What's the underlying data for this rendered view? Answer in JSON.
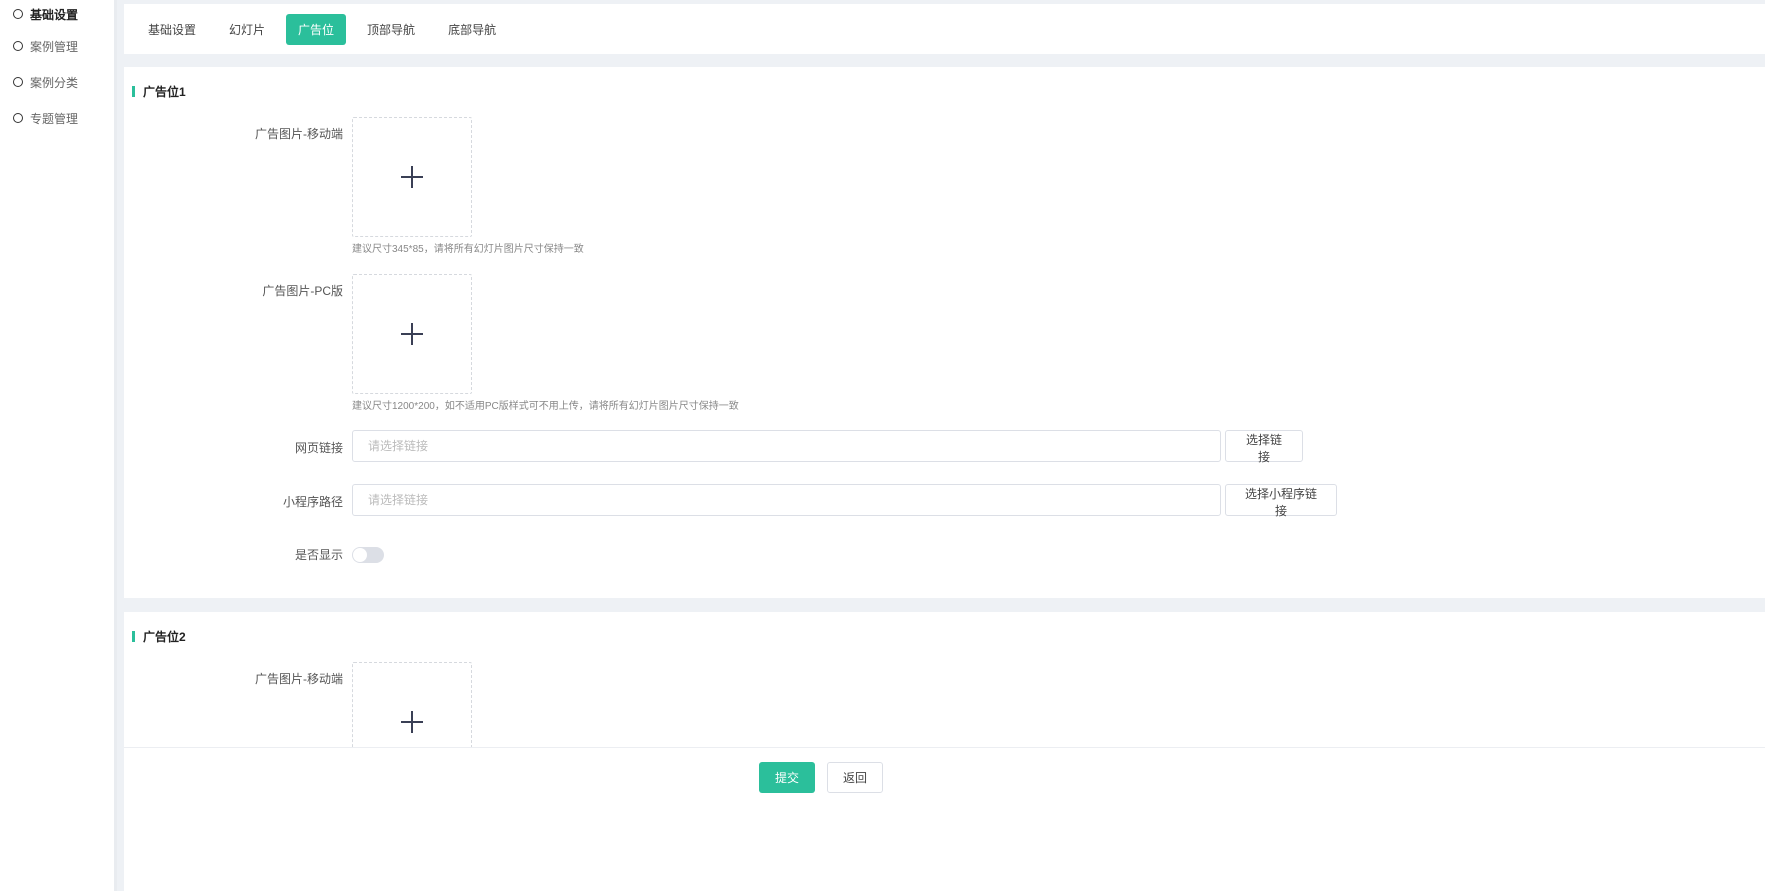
{
  "sidebar": {
    "items": [
      {
        "label": "基础设置",
        "active": true
      },
      {
        "label": "案例管理",
        "active": false
      },
      {
        "label": "案例分类",
        "active": false
      },
      {
        "label": "专题管理",
        "active": false
      }
    ]
  },
  "tabs": [
    {
      "label": "基础设置",
      "active": false
    },
    {
      "label": "幻灯片",
      "active": false
    },
    {
      "label": "广告位",
      "active": true
    },
    {
      "label": "顶部导航",
      "active": false
    },
    {
      "label": "底部导航",
      "active": false
    }
  ],
  "ad1": {
    "title": "广告位1",
    "mobile_label": "广告图片-移动端",
    "mobile_hint": "建议尺寸345*85，请将所有幻灯片图片尺寸保持一致",
    "pc_label": "广告图片-PC版",
    "pc_hint": "建议尺寸1200*200，如不适用PC版样式可不用上传，请将所有幻灯片图片尺寸保持一致",
    "web_link_label": "网页链接",
    "web_link_value": "",
    "web_link_placeholder": "请选择链接",
    "web_link_button": "选择链接",
    "mini_path_label": "小程序路径",
    "mini_path_value": "",
    "mini_path_placeholder": "请选择链接",
    "mini_path_button": "选择小程序链接",
    "show_label": "是否显示",
    "show_enabled": false
  },
  "ad2": {
    "title": "广告位2",
    "mobile_label": "广告图片-移动端"
  },
  "footer": {
    "submit_label": "提交",
    "back_label": "返回"
  },
  "colors": {
    "accent": "#2bbf9b",
    "page_bg": "#eef1f5"
  }
}
